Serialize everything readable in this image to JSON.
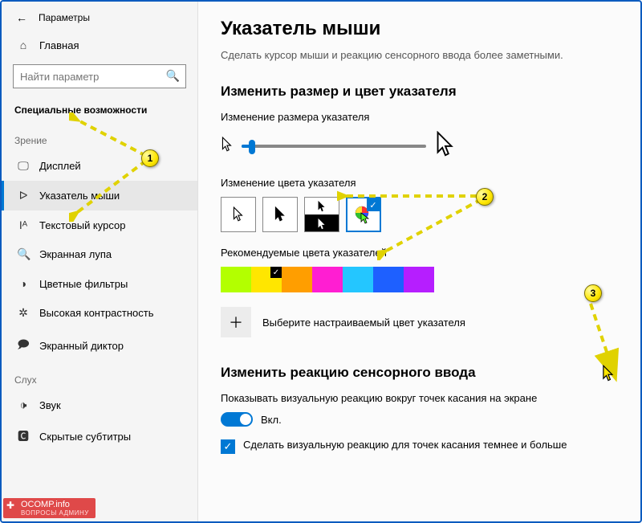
{
  "window": {
    "title": "Параметры"
  },
  "sidebar": {
    "home": "Главная",
    "search_placeholder": "Найти параметр",
    "category": "Специальные возможности",
    "group_vision": "Зрение",
    "group_hearing": "Слух",
    "items": [
      {
        "label": "Дисплей",
        "icon": "🖵"
      },
      {
        "label": "Указатель мыши",
        "icon": "➤"
      },
      {
        "label": "Текстовый курсор",
        "icon": "Iᴬ"
      },
      {
        "label": "Экранная лупа",
        "icon": "🔍"
      },
      {
        "label": "Цветные фильтры",
        "icon": "◑"
      },
      {
        "label": "Высокая контрастность",
        "icon": "✲"
      },
      {
        "label": "Экранный диктор",
        "icon": "🗩"
      }
    ],
    "items2": [
      {
        "label": "Звук",
        "icon": "🕩"
      },
      {
        "label": "Скрытые субтитры",
        "icon": "🅲"
      }
    ]
  },
  "main": {
    "heading": "Указатель мыши",
    "subtitle": "Сделать курсор мыши и реакцию сенсорного ввода более заметными.",
    "size_section": "Изменить размер и цвет указателя",
    "size_label": "Изменение размера указателя",
    "color_label": "Изменение цвета указателя",
    "recommended_label": "Рекомендуемые цвета указателей",
    "recommended_colors": [
      "#b3ff00",
      "#ffe600",
      "#ff9e00",
      "#ff1ed2",
      "#24c6ff",
      "#1e60ff",
      "#b61eff"
    ],
    "recommended_selected": 1,
    "add_color_label": "Выберите настраиваемый цвет указателя",
    "touch_section": "Изменить реакцию сенсорного ввода",
    "touch_desc": "Показывать визуальную реакцию вокруг точек касания на экране",
    "toggle_label": "Вкл.",
    "checkbox_label": "Сделать визуальную реакцию для точек касания темнее и больше"
  },
  "annotations": {
    "b1": "1",
    "b2": "2",
    "b3": "3"
  },
  "watermark": {
    "text": "OCOMP.info",
    "sub": "ВОПРОСЫ АДМИНУ"
  }
}
